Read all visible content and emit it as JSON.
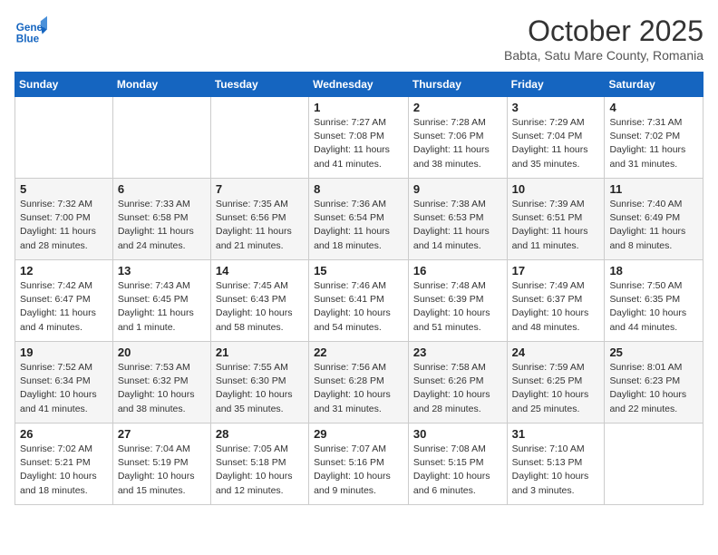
{
  "header": {
    "logo_line1": "General",
    "logo_line2": "Blue",
    "month": "October 2025",
    "location": "Babta, Satu Mare County, Romania"
  },
  "weekdays": [
    "Sunday",
    "Monday",
    "Tuesday",
    "Wednesday",
    "Thursday",
    "Friday",
    "Saturday"
  ],
  "weeks": [
    [
      {
        "day": "",
        "detail": ""
      },
      {
        "day": "",
        "detail": ""
      },
      {
        "day": "",
        "detail": ""
      },
      {
        "day": "1",
        "detail": "Sunrise: 7:27 AM\nSunset: 7:08 PM\nDaylight: 11 hours\nand 41 minutes."
      },
      {
        "day": "2",
        "detail": "Sunrise: 7:28 AM\nSunset: 7:06 PM\nDaylight: 11 hours\nand 38 minutes."
      },
      {
        "day": "3",
        "detail": "Sunrise: 7:29 AM\nSunset: 7:04 PM\nDaylight: 11 hours\nand 35 minutes."
      },
      {
        "day": "4",
        "detail": "Sunrise: 7:31 AM\nSunset: 7:02 PM\nDaylight: 11 hours\nand 31 minutes."
      }
    ],
    [
      {
        "day": "5",
        "detail": "Sunrise: 7:32 AM\nSunset: 7:00 PM\nDaylight: 11 hours\nand 28 minutes."
      },
      {
        "day": "6",
        "detail": "Sunrise: 7:33 AM\nSunset: 6:58 PM\nDaylight: 11 hours\nand 24 minutes."
      },
      {
        "day": "7",
        "detail": "Sunrise: 7:35 AM\nSunset: 6:56 PM\nDaylight: 11 hours\nand 21 minutes."
      },
      {
        "day": "8",
        "detail": "Sunrise: 7:36 AM\nSunset: 6:54 PM\nDaylight: 11 hours\nand 18 minutes."
      },
      {
        "day": "9",
        "detail": "Sunrise: 7:38 AM\nSunset: 6:53 PM\nDaylight: 11 hours\nand 14 minutes."
      },
      {
        "day": "10",
        "detail": "Sunrise: 7:39 AM\nSunset: 6:51 PM\nDaylight: 11 hours\nand 11 minutes."
      },
      {
        "day": "11",
        "detail": "Sunrise: 7:40 AM\nSunset: 6:49 PM\nDaylight: 11 hours\nand 8 minutes."
      }
    ],
    [
      {
        "day": "12",
        "detail": "Sunrise: 7:42 AM\nSunset: 6:47 PM\nDaylight: 11 hours\nand 4 minutes."
      },
      {
        "day": "13",
        "detail": "Sunrise: 7:43 AM\nSunset: 6:45 PM\nDaylight: 11 hours\nand 1 minute."
      },
      {
        "day": "14",
        "detail": "Sunrise: 7:45 AM\nSunset: 6:43 PM\nDaylight: 10 hours\nand 58 minutes."
      },
      {
        "day": "15",
        "detail": "Sunrise: 7:46 AM\nSunset: 6:41 PM\nDaylight: 10 hours\nand 54 minutes."
      },
      {
        "day": "16",
        "detail": "Sunrise: 7:48 AM\nSunset: 6:39 PM\nDaylight: 10 hours\nand 51 minutes."
      },
      {
        "day": "17",
        "detail": "Sunrise: 7:49 AM\nSunset: 6:37 PM\nDaylight: 10 hours\nand 48 minutes."
      },
      {
        "day": "18",
        "detail": "Sunrise: 7:50 AM\nSunset: 6:35 PM\nDaylight: 10 hours\nand 44 minutes."
      }
    ],
    [
      {
        "day": "19",
        "detail": "Sunrise: 7:52 AM\nSunset: 6:34 PM\nDaylight: 10 hours\nand 41 minutes."
      },
      {
        "day": "20",
        "detail": "Sunrise: 7:53 AM\nSunset: 6:32 PM\nDaylight: 10 hours\nand 38 minutes."
      },
      {
        "day": "21",
        "detail": "Sunrise: 7:55 AM\nSunset: 6:30 PM\nDaylight: 10 hours\nand 35 minutes."
      },
      {
        "day": "22",
        "detail": "Sunrise: 7:56 AM\nSunset: 6:28 PM\nDaylight: 10 hours\nand 31 minutes."
      },
      {
        "day": "23",
        "detail": "Sunrise: 7:58 AM\nSunset: 6:26 PM\nDaylight: 10 hours\nand 28 minutes."
      },
      {
        "day": "24",
        "detail": "Sunrise: 7:59 AM\nSunset: 6:25 PM\nDaylight: 10 hours\nand 25 minutes."
      },
      {
        "day": "25",
        "detail": "Sunrise: 8:01 AM\nSunset: 6:23 PM\nDaylight: 10 hours\nand 22 minutes."
      }
    ],
    [
      {
        "day": "26",
        "detail": "Sunrise: 7:02 AM\nSunset: 5:21 PM\nDaylight: 10 hours\nand 18 minutes."
      },
      {
        "day": "27",
        "detail": "Sunrise: 7:04 AM\nSunset: 5:19 PM\nDaylight: 10 hours\nand 15 minutes."
      },
      {
        "day": "28",
        "detail": "Sunrise: 7:05 AM\nSunset: 5:18 PM\nDaylight: 10 hours\nand 12 minutes."
      },
      {
        "day": "29",
        "detail": "Sunrise: 7:07 AM\nSunset: 5:16 PM\nDaylight: 10 hours\nand 9 minutes."
      },
      {
        "day": "30",
        "detail": "Sunrise: 7:08 AM\nSunset: 5:15 PM\nDaylight: 10 hours\nand 6 minutes."
      },
      {
        "day": "31",
        "detail": "Sunrise: 7:10 AM\nSunset: 5:13 PM\nDaylight: 10 hours\nand 3 minutes."
      },
      {
        "day": "",
        "detail": ""
      }
    ]
  ]
}
